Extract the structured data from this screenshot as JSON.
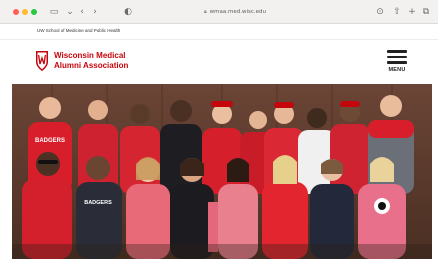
{
  "browser": {
    "url": "wmaa.med.wisc.edu"
  },
  "utility_bar": {
    "text": "UW School of Medicine and Public Health"
  },
  "header": {
    "brand_line1": "Wisconsin Medical",
    "brand_line2": "Alumni Association",
    "menu_label": "MENU"
  },
  "hero": {
    "subject": "group-photo",
    "shirt_texts": [
      "BADGERS",
      "BADGERS"
    ]
  },
  "colors": {
    "brand_red": "#c5050c",
    "chrome_bg": "#f3f1f0"
  }
}
